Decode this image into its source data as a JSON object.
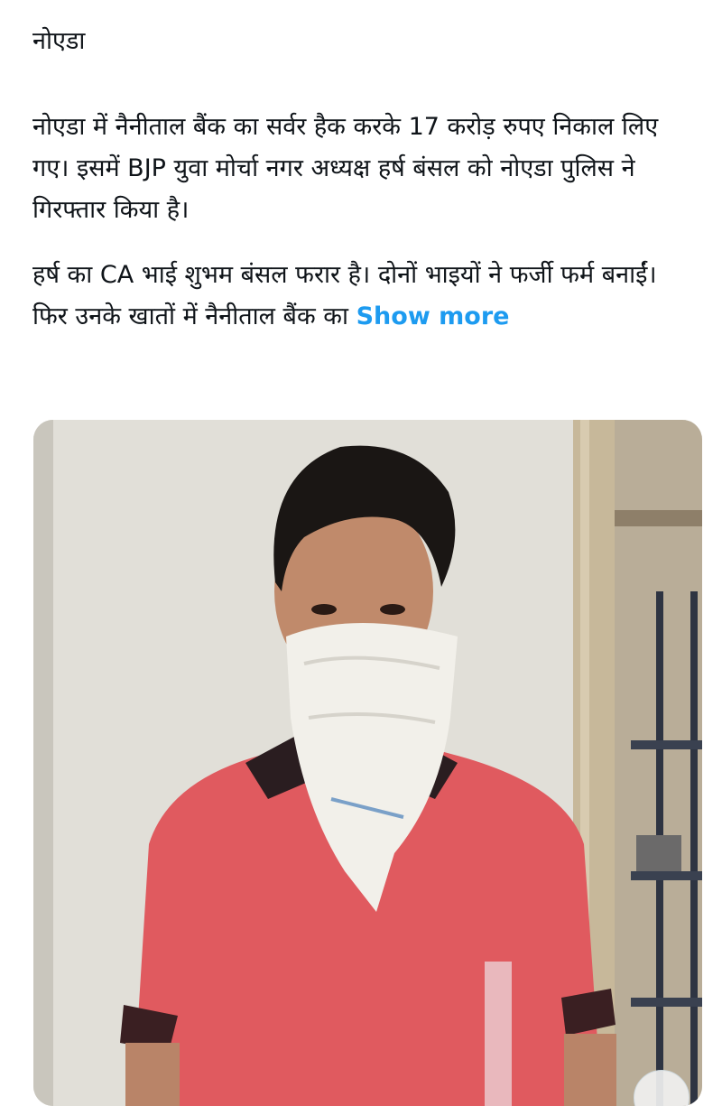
{
  "post": {
    "header": "नोएडा",
    "paragraph1": "नोएडा में नैनीताल बैंक का सर्वर हैक करके 17 करोड़ रुपए निकाल लिए गए। इसमें BJP युवा मोर्चा नगर अध्यक्ष हर्ष बंसल को नोएडा पुलिस ने गिरफ्तार किया है।",
    "paragraph2": "हर्ष का CA भाई शुभम बंसल फरार है। दोनों भाइयों ने फर्जी फर्म बनाईं। फिर उनके खातों में नैनीताल बैंक का",
    "show_more_label": "Show more"
  },
  "colors": {
    "link": "#1d9bf0",
    "text": "#0f1419",
    "shirt": "#e05a5f"
  }
}
